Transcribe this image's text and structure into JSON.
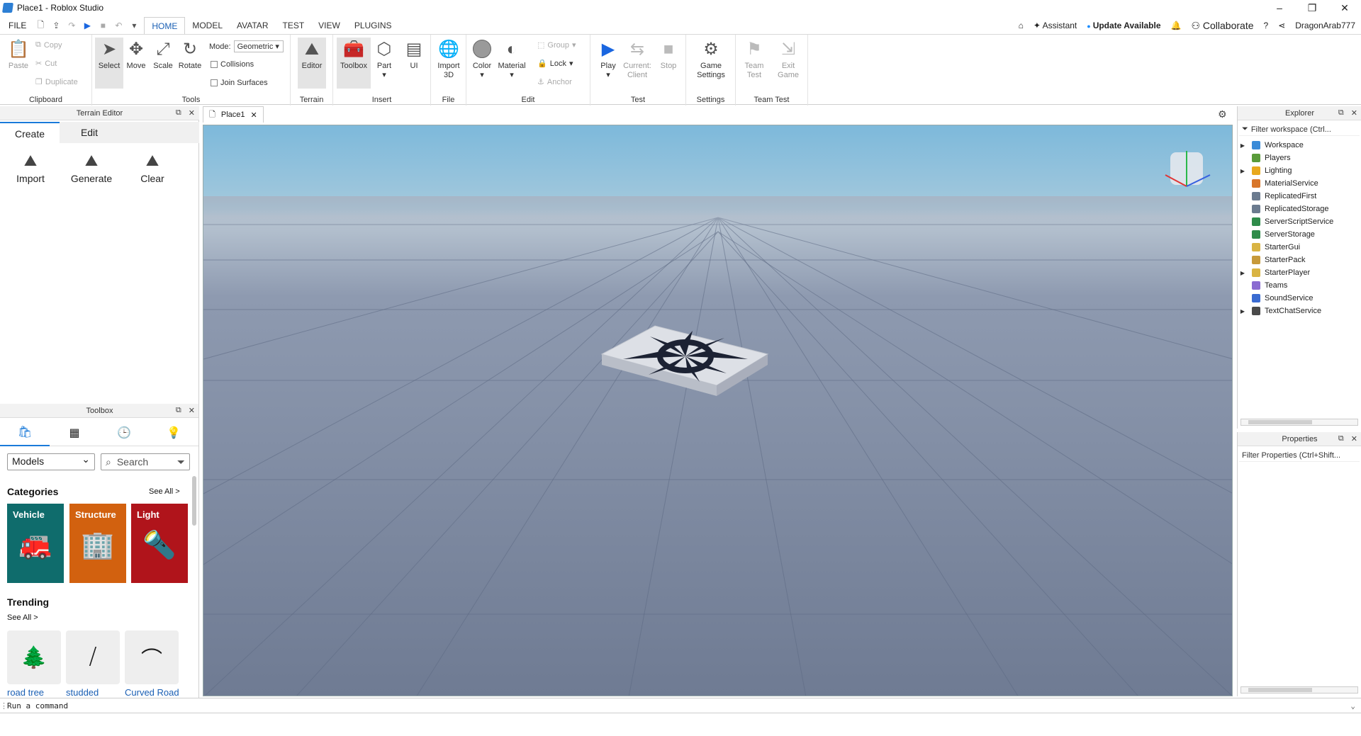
{
  "window": {
    "title": "Place1 - Roblox Studio",
    "controls": [
      "–",
      "❐",
      "✕"
    ]
  },
  "menu": {
    "file": "FILE",
    "tabs": [
      "HOME",
      "MODEL",
      "AVATAR",
      "TEST",
      "VIEW",
      "PLUGINS"
    ],
    "active_tab": "HOME",
    "right": {
      "assistant": "Assistant",
      "update": "Update Available",
      "collaborate": "Collaborate",
      "user": "DragonArab777"
    }
  },
  "ribbon": {
    "clipboard": {
      "label": "Clipboard",
      "paste": "Paste",
      "copy": "Copy",
      "cut": "Cut",
      "duplicate": "Duplicate"
    },
    "tools": {
      "label": "Tools",
      "select": "Select",
      "move": "Move",
      "scale": "Scale",
      "rotate": "Rotate",
      "mode_label": "Mode:",
      "mode_value": "Geometric",
      "collisions": "Collisions",
      "join_surfaces": "Join Surfaces"
    },
    "terrain": {
      "label": "Terrain",
      "editor": "Editor"
    },
    "insert": {
      "label": "Insert",
      "toolbox": "Toolbox",
      "part": "Part",
      "ui": "UI"
    },
    "file": {
      "label": "File",
      "import3d_1": "Import",
      "import3d_2": "3D"
    },
    "edit": {
      "label": "Edit",
      "color": "Color",
      "material": "Material",
      "group": "Group",
      "lock": "Lock",
      "anchor": "Anchor"
    },
    "test": {
      "label": "Test",
      "play": "Play",
      "current_client_1": "Current:",
      "current_client_2": "Client",
      "stop": "Stop"
    },
    "settings": {
      "label": "Settings",
      "game_settings_1": "Game",
      "game_settings_2": "Settings"
    },
    "team_test": {
      "label": "Team Test",
      "team_test_1": "Team",
      "team_test_2": "Test",
      "exit_game_1": "Exit",
      "exit_game_2": "Game"
    }
  },
  "terrain_editor": {
    "title": "Terrain Editor",
    "tabs": [
      "Create",
      "Edit"
    ],
    "actions": [
      "Import",
      "Generate",
      "Clear"
    ]
  },
  "toolbox": {
    "title": "Toolbox",
    "category_select": "Models",
    "search_placeholder": "Search",
    "categories_heading": "Categories",
    "see_all": "See All >",
    "categories": [
      {
        "name": "Vehicle",
        "color": "#0f6c6c"
      },
      {
        "name": "Structure",
        "color": "#d2610f"
      },
      {
        "name": "Light",
        "color": "#b0141b"
      }
    ],
    "trending_heading": "Trending",
    "trending_see_all": "See All >",
    "trending": [
      "road tree",
      "studded",
      "Curved Road"
    ]
  },
  "document": {
    "tab": "Place1"
  },
  "explorer": {
    "title": "Explorer",
    "filter": "Filter workspace (Ctrl...",
    "items": [
      {
        "name": "Workspace",
        "expandable": true,
        "color": "#3a8bd8"
      },
      {
        "name": "Players",
        "expandable": false,
        "color": "#5a9b3a"
      },
      {
        "name": "Lighting",
        "expandable": true,
        "color": "#e8a91e"
      },
      {
        "name": "MaterialService",
        "expandable": false,
        "color": "#d8762a"
      },
      {
        "name": "ReplicatedFirst",
        "expandable": false,
        "color": "#6b7b8f"
      },
      {
        "name": "ReplicatedStorage",
        "expandable": false,
        "color": "#6b7b8f"
      },
      {
        "name": "ServerScriptService",
        "expandable": false,
        "color": "#2f8c4a"
      },
      {
        "name": "ServerStorage",
        "expandable": false,
        "color": "#2f8c4a"
      },
      {
        "name": "StarterGui",
        "expandable": false,
        "color": "#d9b443"
      },
      {
        "name": "StarterPack",
        "expandable": false,
        "color": "#c79a3a"
      },
      {
        "name": "StarterPlayer",
        "expandable": true,
        "color": "#d9b443"
      },
      {
        "name": "Teams",
        "expandable": false,
        "color": "#8a6bd1"
      },
      {
        "name": "SoundService",
        "expandable": false,
        "color": "#3a6bd1"
      },
      {
        "name": "TextChatService",
        "expandable": true,
        "color": "#4a4a4a"
      }
    ]
  },
  "properties": {
    "title": "Properties",
    "filter": "Filter Properties (Ctrl+Shift..."
  },
  "command_bar": {
    "placeholder": "Run a command"
  }
}
